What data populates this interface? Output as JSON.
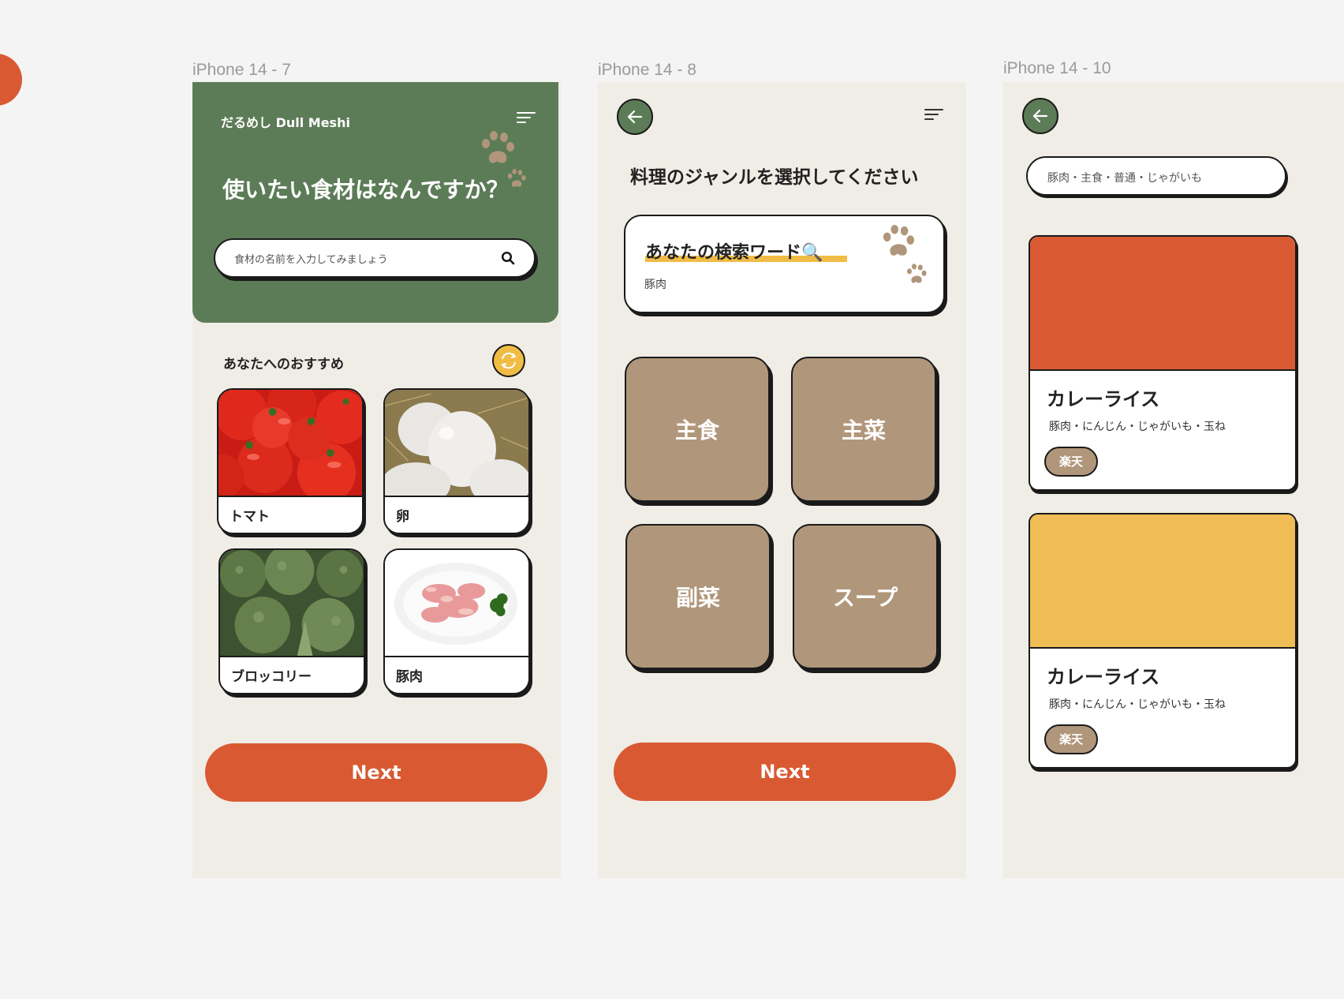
{
  "frames": {
    "f1": {
      "label": "iPhone 14 - 7"
    },
    "f2": {
      "label": "iPhone 14 - 8"
    },
    "f3": {
      "label": "iPhone 14 - 10"
    }
  },
  "screen1": {
    "brand": "だるめし Dull Meshi",
    "title": "使いたい食材はなんですか？",
    "search_placeholder": "食材の名前を入力してみましょう",
    "section_title": "あなたへのおすすめ",
    "ingredients": [
      "トマト",
      "卵",
      "ブロッコリー",
      "豚肉"
    ],
    "next_label": "Next"
  },
  "screen2": {
    "question": "料理のジャンルを選択してください",
    "keyword_title": "あなたの検索ワード🔍",
    "keyword_value": "豚肉",
    "genres": [
      "主食",
      "主菜",
      "副菜",
      "スープ"
    ],
    "next_label": "Next"
  },
  "screen3": {
    "filter": "豚肉・主食・普通・じゃがいも",
    "recipes": [
      {
        "name": "カレーライス",
        "ingredients": "豚肉・にんじん・じゃがいも・玉ね",
        "tag": "楽天",
        "color": "#d95a32"
      },
      {
        "name": "カレーライス",
        "ingredients": "豚肉・にんじん・じゃがいも・玉ね",
        "tag": "楽天",
        "color": "#f0bc55"
      }
    ]
  },
  "colors": {
    "green": "#5c7c57",
    "orange": "#d95a32",
    "yellow": "#f0bc45",
    "tan": "#b0967a",
    "bg": "#f0ede6"
  }
}
